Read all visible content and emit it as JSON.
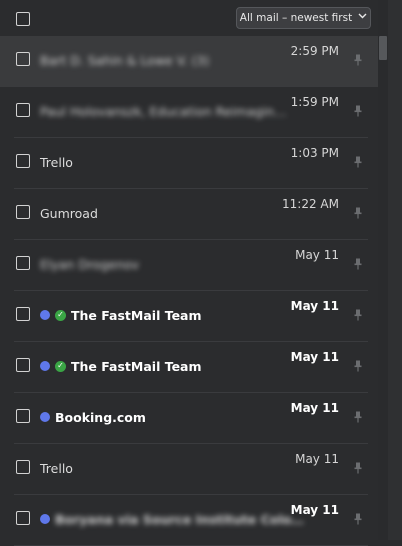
{
  "toolbar": {
    "sort_label": "All mail – newest first",
    "chevron_icon": "chevron-down-icon"
  },
  "messages": [
    {
      "sender": "Bart D. Sahin & Lowe V. (3)",
      "time": "2:59 PM",
      "unread": false,
      "blurred": true,
      "dot": false,
      "verified": false
    },
    {
      "sender": "Paul Holovanszk, Education Reimagin…",
      "time": "1:59 PM",
      "unread": false,
      "blurred": true,
      "dot": false,
      "verified": false
    },
    {
      "sender": "Trello",
      "time": "1:03 PM",
      "unread": false,
      "blurred": false,
      "dot": false,
      "verified": false
    },
    {
      "sender": "Gumroad",
      "time": "11:22 AM",
      "unread": false,
      "blurred": false,
      "dot": false,
      "verified": false
    },
    {
      "sender": "Elyan Drogenov",
      "time": "May 11",
      "unread": false,
      "blurred": true,
      "dot": false,
      "verified": false
    },
    {
      "sender": "The FastMail Team",
      "time": "May 11",
      "unread": true,
      "blurred": false,
      "dot": true,
      "verified": true
    },
    {
      "sender": "The FastMail Team",
      "time": "May 11",
      "unread": true,
      "blurred": false,
      "dot": true,
      "verified": true
    },
    {
      "sender": "Booking.com",
      "time": "May 11",
      "unread": true,
      "blurred": false,
      "dot": true,
      "verified": false
    },
    {
      "sender": "Trello",
      "time": "May 11",
      "unread": false,
      "blurred": false,
      "dot": false,
      "verified": false
    },
    {
      "sender": "Boryana via Source Institute Colo…",
      "time": "May 11",
      "unread": true,
      "blurred": true,
      "dot": true,
      "verified": false
    }
  ],
  "colors": {
    "background": "#2b2c2e",
    "unread_dot": "#5f78ea",
    "verified": "#3aa545",
    "selected_row": "#3a3b3d"
  }
}
